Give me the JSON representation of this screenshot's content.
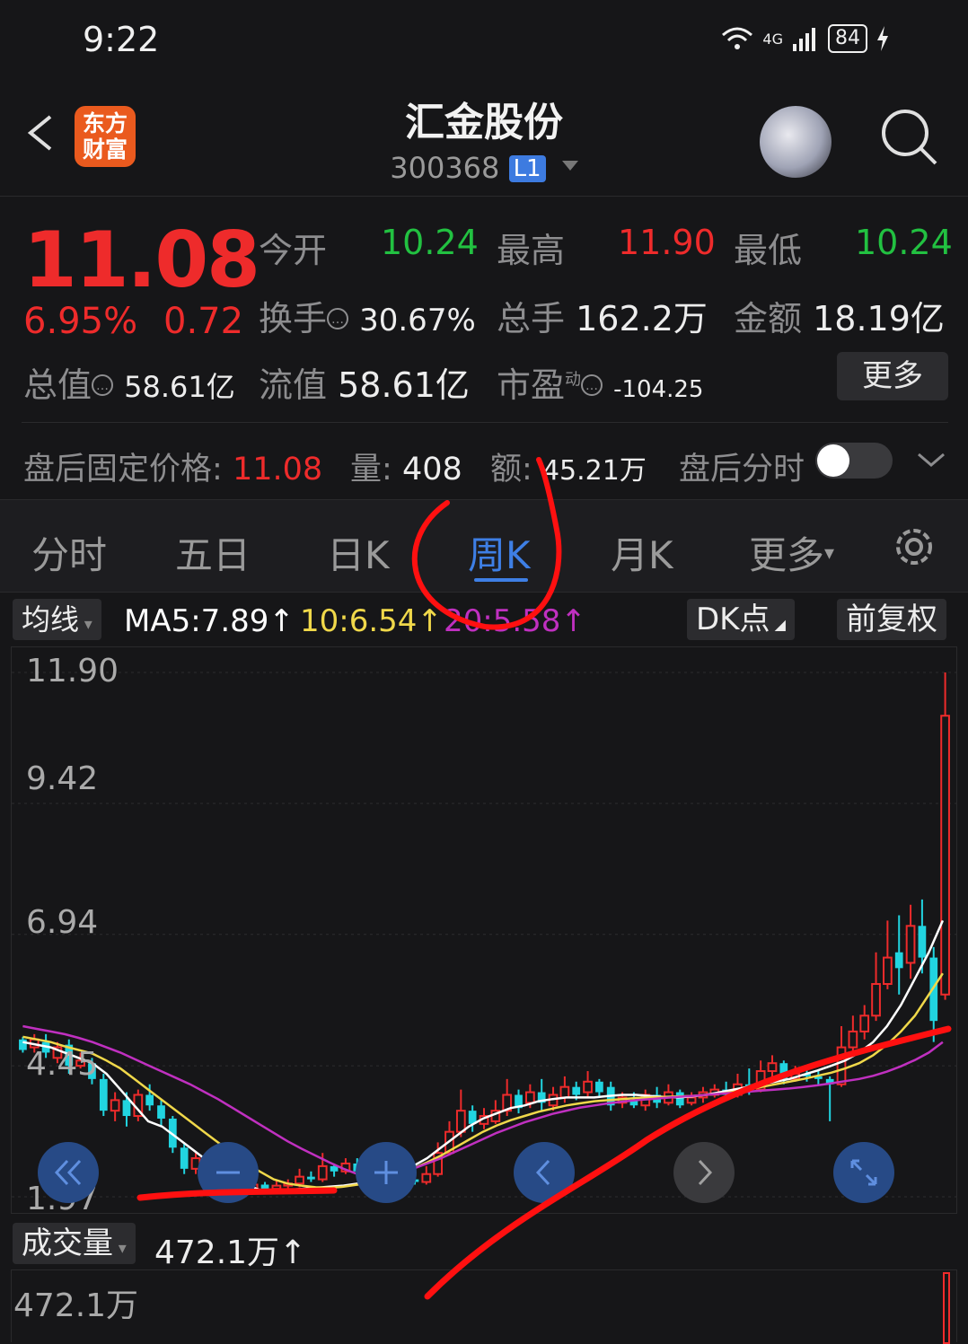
{
  "status": {
    "time": "9:22",
    "network": "4G",
    "battery": "84"
  },
  "header": {
    "logo_text": "东方财富",
    "title": "汇金股份",
    "code": "300368",
    "level_badge": "L1"
  },
  "quote": {
    "price": "11.08",
    "change_pct": "6.95%",
    "change_amt": "0.72",
    "open_label": "今开",
    "open": "10.24",
    "high_label": "最高",
    "high": "11.90",
    "low_label": "最低",
    "low": "10.24",
    "turnover_label": "换手",
    "turnover": "30.67%",
    "volume_label": "总手",
    "volume": "162.2万",
    "amount_label": "金额",
    "amount": "18.19亿",
    "mktcap_label": "总值",
    "mktcap": "58.61亿",
    "float_label": "流值",
    "float_cap": "58.61亿",
    "pe_label": "市盈",
    "pe_sup": "动",
    "pe": "-104.25",
    "more_button": "更多"
  },
  "after_hours": {
    "price_label": "盘后固定价格:",
    "price": "11.08",
    "vol_label": "量:",
    "vol": "408",
    "amt_label": "额:",
    "amt": "45.21万",
    "toggle_label": "盘后分时"
  },
  "tabs": [
    "分时",
    "五日",
    "日K",
    "周K",
    "月K",
    "更多"
  ],
  "active_tab": "周K",
  "ma": {
    "selector": "均线",
    "ma5": "MA5:7.89↑",
    "ma10": "10:6.54↑",
    "ma20": "20:5.58↑",
    "dk_button": "DK点",
    "adjust_button": "前复权",
    "colors": {
      "ma5": "#ffffff",
      "ma10": "#f0d84a",
      "ma20": "#c030c0"
    }
  },
  "chart_data": {
    "type": "candlestick",
    "y_ticks": [
      "11.90",
      "9.42",
      "6.94",
      "4.45",
      "1.97"
    ],
    "ylim": [
      1.97,
      11.9
    ],
    "candles": [
      {
        "o": 4.95,
        "c": 4.75,
        "h": 5.0,
        "l": 4.7
      },
      {
        "o": 4.8,
        "c": 4.95,
        "h": 5.05,
        "l": 4.7
      },
      {
        "o": 4.9,
        "c": 4.7,
        "h": 5.05,
        "l": 4.6
      },
      {
        "o": 4.6,
        "c": 4.8,
        "h": 4.9,
        "l": 4.5
      },
      {
        "o": 4.85,
        "c": 4.45,
        "h": 4.95,
        "l": 4.3
      },
      {
        "o": 4.45,
        "c": 4.55,
        "h": 4.7,
        "l": 4.4
      },
      {
        "o": 4.5,
        "c": 4.2,
        "h": 4.6,
        "l": 4.1
      },
      {
        "o": 4.2,
        "c": 3.6,
        "h": 4.3,
        "l": 3.5
      },
      {
        "o": 3.6,
        "c": 3.8,
        "h": 3.95,
        "l": 3.4
      },
      {
        "o": 3.8,
        "c": 3.5,
        "h": 3.95,
        "l": 3.3
      },
      {
        "o": 3.5,
        "c": 3.9,
        "h": 4.0,
        "l": 3.4
      },
      {
        "o": 3.9,
        "c": 3.7,
        "h": 4.1,
        "l": 3.6
      },
      {
        "o": 3.7,
        "c": 3.45,
        "h": 3.8,
        "l": 3.3
      },
      {
        "o": 3.45,
        "c": 2.9,
        "h": 3.5,
        "l": 2.8
      },
      {
        "o": 2.9,
        "c": 2.5,
        "h": 3.0,
        "l": 2.4
      },
      {
        "o": 2.5,
        "c": 2.7,
        "h": 2.8,
        "l": 2.4
      },
      {
        "o": 2.7,
        "c": 2.2,
        "h": 2.8,
        "l": 2.1
      },
      {
        "o": 2.2,
        "c": 2.05,
        "h": 2.3,
        "l": 2.0
      },
      {
        "o": 2.05,
        "c": 2.15,
        "h": 2.25,
        "l": 1.97
      },
      {
        "o": 2.15,
        "c": 2.1,
        "h": 2.2,
        "l": 2.0
      },
      {
        "o": 2.1,
        "c": 2.2,
        "h": 2.35,
        "l": 2.05
      },
      {
        "o": 2.2,
        "c": 2.12,
        "h": 2.25,
        "l": 2.05
      },
      {
        "o": 2.12,
        "c": 2.18,
        "h": 2.3,
        "l": 2.08
      },
      {
        "o": 2.18,
        "c": 2.22,
        "h": 2.3,
        "l": 2.1
      },
      {
        "o": 2.22,
        "c": 2.35,
        "h": 2.5,
        "l": 2.15
      },
      {
        "o": 2.35,
        "c": 2.3,
        "h": 2.45,
        "l": 2.25
      },
      {
        "o": 2.3,
        "c": 2.55,
        "h": 2.8,
        "l": 2.25
      },
      {
        "o": 2.55,
        "c": 2.45,
        "h": 2.6,
        "l": 2.35
      },
      {
        "o": 2.45,
        "c": 2.6,
        "h": 2.7,
        "l": 2.4
      },
      {
        "o": 2.6,
        "c": 2.45,
        "h": 2.7,
        "l": 2.4
      },
      {
        "o": 2.45,
        "c": 2.4,
        "h": 2.55,
        "l": 2.35
      },
      {
        "o": 2.4,
        "c": 2.35,
        "h": 2.48,
        "l": 2.3
      },
      {
        "o": 2.35,
        "c": 2.45,
        "h": 2.6,
        "l": 2.3
      },
      {
        "o": 2.45,
        "c": 2.3,
        "h": 2.5,
        "l": 2.25
      },
      {
        "o": 2.3,
        "c": 2.25,
        "h": 2.4,
        "l": 2.2
      },
      {
        "o": 2.25,
        "c": 2.4,
        "h": 2.55,
        "l": 2.2
      },
      {
        "o": 2.4,
        "c": 2.8,
        "h": 3.0,
        "l": 2.35
      },
      {
        "o": 2.8,
        "c": 3.2,
        "h": 3.4,
        "l": 2.75
      },
      {
        "o": 3.2,
        "c": 3.6,
        "h": 4.0,
        "l": 3.1
      },
      {
        "o": 3.6,
        "c": 3.35,
        "h": 3.7,
        "l": 3.2
      },
      {
        "o": 3.35,
        "c": 3.5,
        "h": 3.65,
        "l": 3.25
      },
      {
        "o": 3.4,
        "c": 3.6,
        "h": 3.8,
        "l": 3.35
      },
      {
        "o": 3.6,
        "c": 3.9,
        "h": 4.2,
        "l": 3.5
      },
      {
        "o": 3.9,
        "c": 3.65,
        "h": 4.0,
        "l": 3.55
      },
      {
        "o": 3.75,
        "c": 3.95,
        "h": 4.1,
        "l": 3.65
      },
      {
        "o": 3.95,
        "c": 3.75,
        "h": 4.2,
        "l": 3.6
      },
      {
        "o": 3.7,
        "c": 3.9,
        "h": 4.05,
        "l": 3.6
      },
      {
        "o": 3.85,
        "c": 4.05,
        "h": 4.25,
        "l": 3.75
      },
      {
        "o": 4.05,
        "c": 3.9,
        "h": 4.15,
        "l": 3.8
      },
      {
        "o": 3.95,
        "c": 4.15,
        "h": 4.35,
        "l": 3.85
      },
      {
        "o": 4.15,
        "c": 3.95,
        "h": 4.2,
        "l": 3.85
      },
      {
        "o": 4.05,
        "c": 3.7,
        "h": 4.15,
        "l": 3.6
      },
      {
        "o": 3.75,
        "c": 3.85,
        "h": 3.95,
        "l": 3.65
      },
      {
        "o": 3.8,
        "c": 3.7,
        "h": 3.95,
        "l": 3.65
      },
      {
        "o": 3.7,
        "c": 3.9,
        "h": 4.0,
        "l": 3.6
      },
      {
        "o": 3.9,
        "c": 3.75,
        "h": 4.05,
        "l": 3.65
      },
      {
        "o": 3.75,
        "c": 3.95,
        "h": 4.1,
        "l": 3.7
      },
      {
        "o": 3.95,
        "c": 3.7,
        "h": 4.0,
        "l": 3.65
      },
      {
        "o": 3.75,
        "c": 3.85,
        "h": 3.95,
        "l": 3.7
      },
      {
        "o": 3.85,
        "c": 3.95,
        "h": 4.05,
        "l": 3.75
      },
      {
        "o": 3.9,
        "c": 4.0,
        "h": 4.1,
        "l": 3.85
      },
      {
        "o": 4.0,
        "c": 3.9,
        "h": 4.15,
        "l": 3.85
      },
      {
        "o": 3.9,
        "c": 4.1,
        "h": 4.3,
        "l": 3.85
      },
      {
        "o": 4.1,
        "c": 4.0,
        "h": 4.4,
        "l": 3.9
      },
      {
        "o": 4.0,
        "c": 4.35,
        "h": 4.55,
        "l": 3.95
      },
      {
        "o": 4.35,
        "c": 4.5,
        "h": 4.65,
        "l": 4.2
      },
      {
        "o": 4.5,
        "c": 4.2,
        "h": 4.55,
        "l": 4.1
      },
      {
        "o": 4.2,
        "c": 4.3,
        "h": 4.45,
        "l": 4.15
      },
      {
        "o": 4.3,
        "c": 4.25,
        "h": 4.4,
        "l": 4.15
      },
      {
        "o": 4.25,
        "c": 4.2,
        "h": 4.35,
        "l": 4.1
      },
      {
        "o": 4.2,
        "c": 4.1,
        "h": 4.25,
        "l": 3.4
      },
      {
        "o": 4.1,
        "c": 4.8,
        "h": 5.2,
        "l": 4.05
      },
      {
        "o": 4.8,
        "c": 5.1,
        "h": 5.4,
        "l": 4.7
      },
      {
        "o": 5.1,
        "c": 5.4,
        "h": 5.6,
        "l": 4.95
      },
      {
        "o": 5.4,
        "c": 6.0,
        "h": 6.6,
        "l": 5.3
      },
      {
        "o": 6.0,
        "c": 6.5,
        "h": 7.2,
        "l": 5.9
      },
      {
        "o": 6.6,
        "c": 6.3,
        "h": 7.3,
        "l": 5.8
      },
      {
        "o": 6.4,
        "c": 7.1,
        "h": 7.5,
        "l": 6.1
      },
      {
        "o": 7.1,
        "c": 6.5,
        "h": 7.6,
        "l": 6.2
      },
      {
        "o": 6.5,
        "c": 5.3,
        "h": 6.7,
        "l": 4.9
      },
      {
        "o": 5.8,
        "c": 11.08,
        "h": 11.9,
        "l": 5.7
      }
    ],
    "ma5": [
      4.9,
      4.85,
      4.8,
      4.7,
      4.6,
      4.5,
      4.3,
      4.0,
      3.7,
      3.4,
      3.3,
      3.1,
      2.9,
      2.7,
      2.5,
      2.35,
      2.2,
      2.1,
      2.08,
      2.1,
      2.12,
      2.14,
      2.16,
      2.18,
      2.22,
      2.28,
      2.36,
      2.45,
      2.55,
      2.7,
      2.9,
      3.1,
      3.3,
      3.45,
      3.55,
      3.65,
      3.7,
      3.78,
      3.82,
      3.85,
      3.85,
      3.85,
      3.88,
      3.9,
      3.9,
      3.88,
      3.86,
      3.85,
      3.87,
      3.9,
      3.95,
      4.0,
      4.05,
      4.1,
      4.15,
      4.2,
      4.28,
      4.36,
      4.45,
      4.55,
      4.7,
      4.9,
      5.2,
      5.6,
      6.1,
      6.6,
      7.2
    ],
    "ma10": [
      5.0,
      4.95,
      4.9,
      4.82,
      4.75,
      4.68,
      4.55,
      4.4,
      4.2,
      4.0,
      3.8,
      3.6,
      3.4,
      3.2,
      3.0,
      2.8,
      2.6,
      2.45,
      2.3,
      2.22,
      2.18,
      2.15,
      2.14,
      2.16,
      2.2,
      2.25,
      2.32,
      2.4,
      2.5,
      2.62,
      2.75,
      2.9,
      3.05,
      3.2,
      3.32,
      3.42,
      3.5,
      3.58,
      3.64,
      3.7,
      3.74,
      3.78,
      3.8,
      3.82,
      3.84,
      3.85,
      3.86,
      3.87,
      3.88,
      3.9,
      3.92,
      3.96,
      4.0,
      4.05,
      4.1,
      4.15,
      4.2,
      4.26,
      4.32,
      4.4,
      4.5,
      4.65,
      4.85,
      5.1,
      5.4,
      5.8,
      6.2
    ],
    "ma20": [
      5.2,
      5.15,
      5.1,
      5.05,
      4.98,
      4.9,
      4.8,
      4.7,
      4.58,
      4.46,
      4.34,
      4.22,
      4.1,
      3.96,
      3.82,
      3.66,
      3.5,
      3.34,
      3.18,
      3.02,
      2.88,
      2.75,
      2.62,
      2.5,
      2.4,
      2.35,
      2.36,
      2.42,
      2.5,
      2.6,
      2.7,
      2.82,
      2.94,
      3.06,
      3.18,
      3.28,
      3.38,
      3.46,
      3.54,
      3.6,
      3.66,
      3.7,
      3.74,
      3.77,
      3.8,
      3.82,
      3.84,
      3.86,
      3.88,
      3.9,
      3.92,
      3.94,
      3.96,
      3.98,
      4.0,
      4.02,
      4.05,
      4.08,
      4.12,
      4.16,
      4.2,
      4.26,
      4.34,
      4.44,
      4.56,
      4.7,
      4.9
    ]
  },
  "volume": {
    "selector": "成交量",
    "value": "472.1万↑",
    "axis_top": "472.1万"
  },
  "chart_nav": [
    "rewind-icon",
    "zoom-out-icon",
    "zoom-in-icon",
    "prev-icon",
    "next-icon",
    "fullscreen-icon"
  ]
}
